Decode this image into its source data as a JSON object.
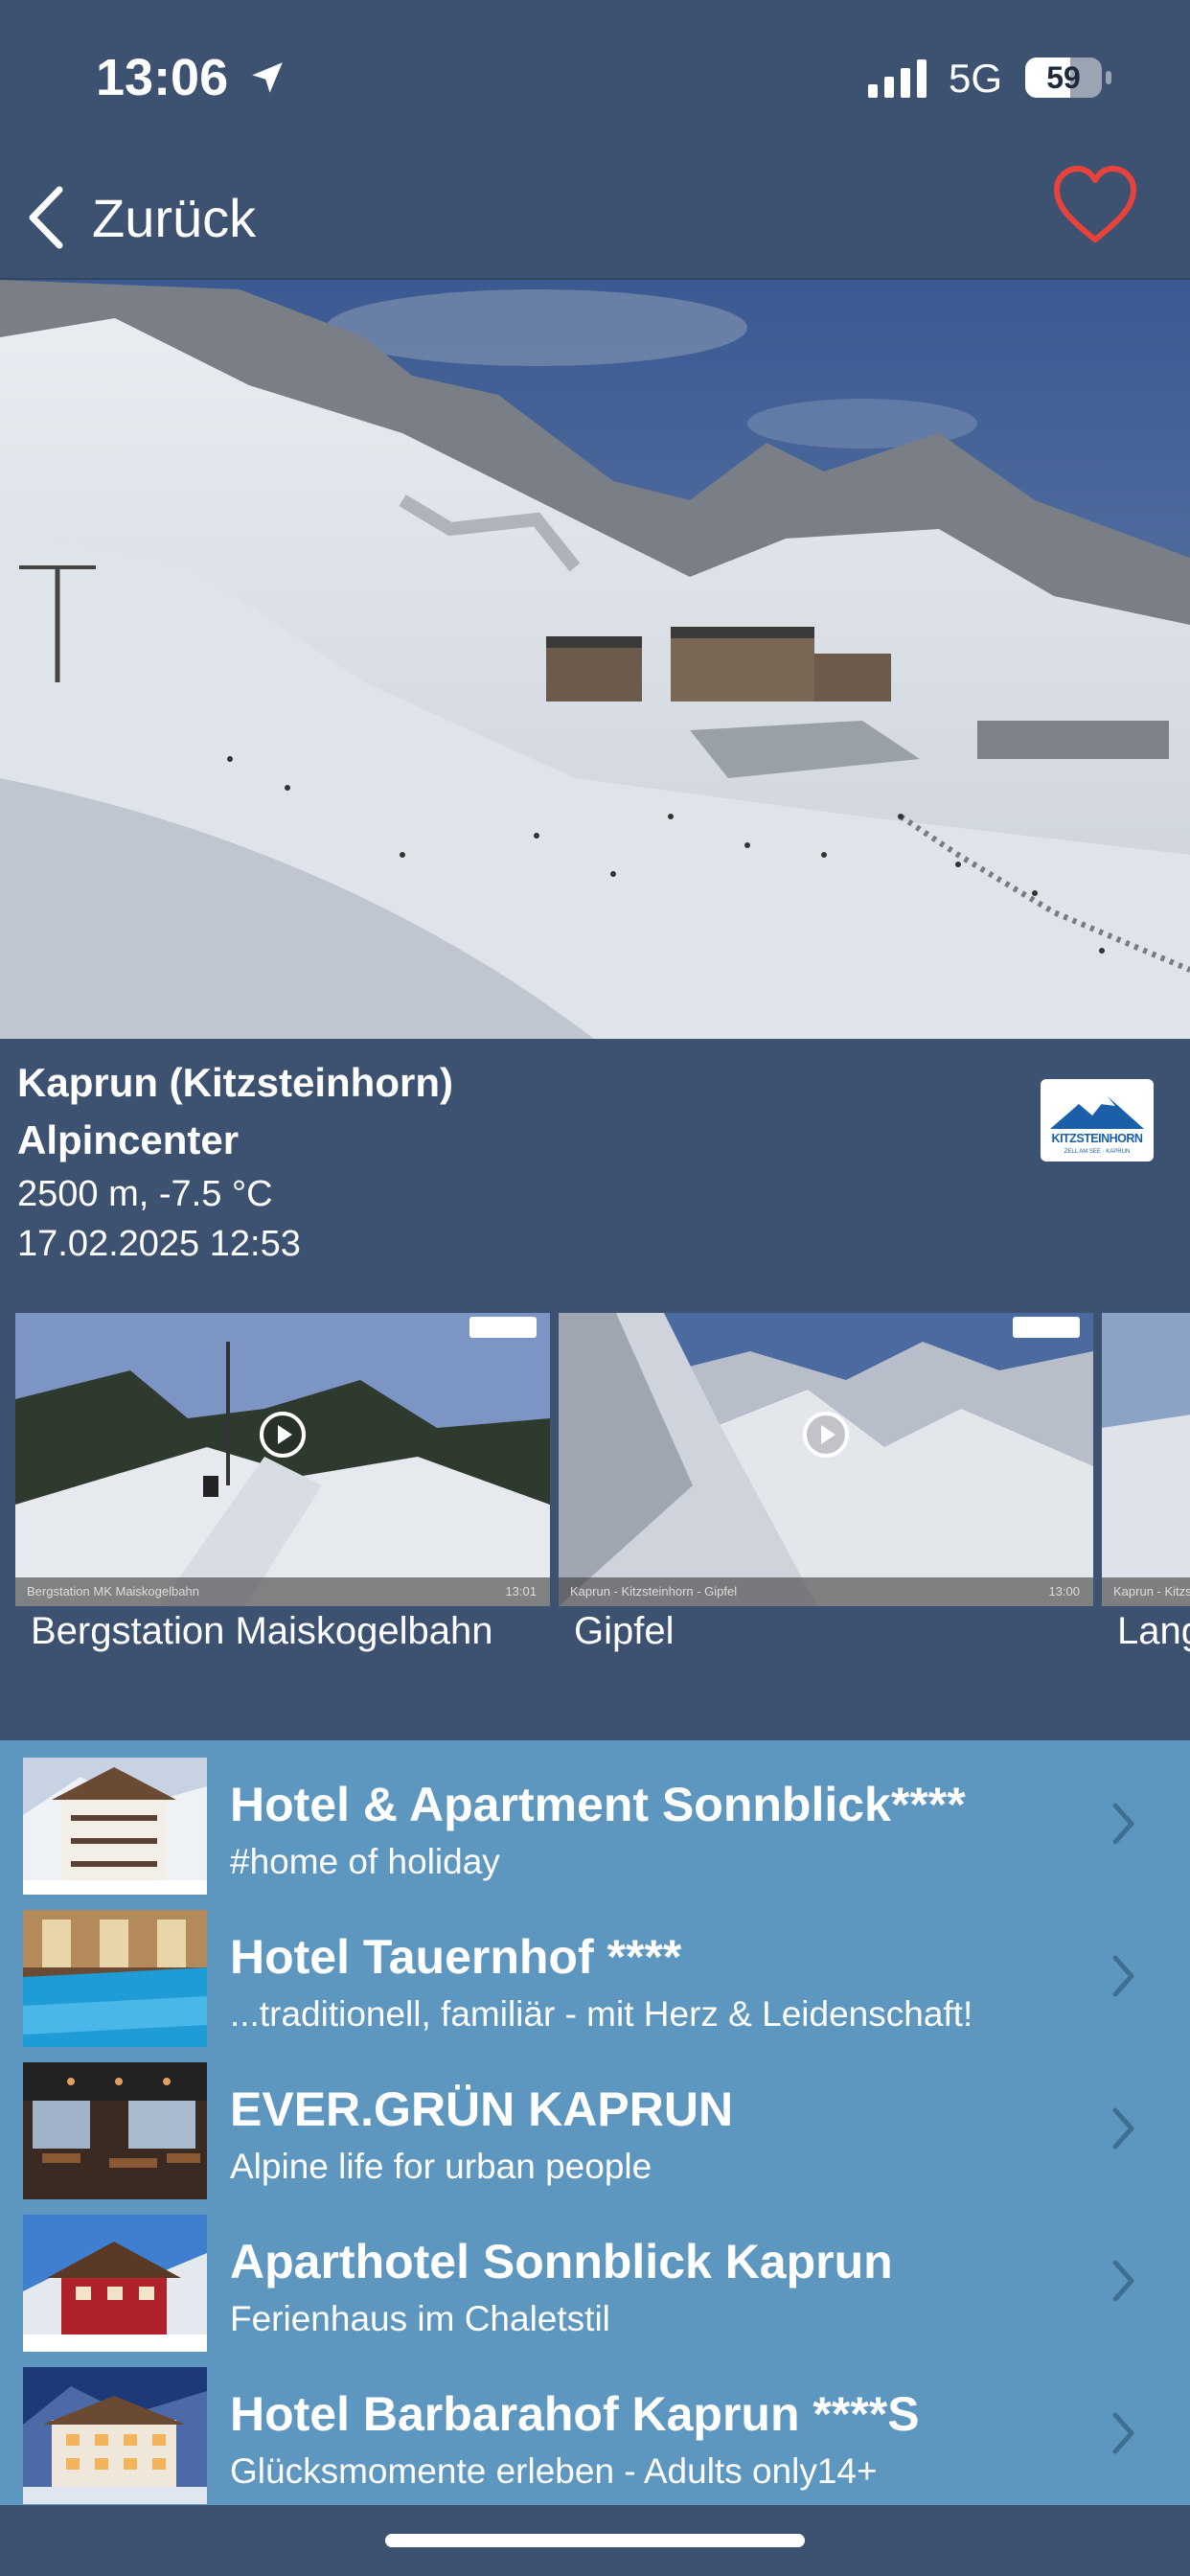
{
  "status_bar": {
    "time": "13:06",
    "network": "5G",
    "battery": "59",
    "battery_level": 0.59,
    "icons": [
      "location-arrow-icon",
      "cellular-signal-icon",
      "battery-icon"
    ]
  },
  "nav": {
    "back_label": "Zurück",
    "favorite_icon": "heart-outline-icon",
    "favorite_color": "#e8423c"
  },
  "webcam": {
    "title_line1": "Kaprun (Kitzsteinhorn)",
    "title_line2": "Alpincenter",
    "altitude_temp": "2500 m, -7.5 °C",
    "timestamp": "17.02.2025 12:53",
    "brand_logo_text": "KITZSTEINHORN",
    "brand_logo_subtext": "ZELL AM SEE · KAPRUN"
  },
  "related_cams": [
    {
      "label": "Bergstation Maiskogelbahn",
      "caption_left": "Bergstation MK Maiskogelbahn",
      "caption_right": "13:01"
    },
    {
      "label": "Gipfel",
      "caption_left": "Kaprun - Kitzsteinhorn - Gipfel",
      "caption_right": "13:00"
    },
    {
      "label": "Lang",
      "caption_left": "Kaprun - Kitzst",
      "caption_right": ""
    }
  ],
  "hotels": [
    {
      "name": "Hotel & Apartment Sonnblick****",
      "tagline": "#home of holiday"
    },
    {
      "name": "Hotel Tauernhof ****",
      "tagline": "...traditionell, familiär - mit Herz & Leidenschaft!"
    },
    {
      "name": "EVER.GRÜN KAPRUN",
      "tagline": "Alpine life for urban people"
    },
    {
      "name": "Aparthotel Sonnblick Kaprun",
      "tagline": "Ferienhaus im Chaletstil"
    },
    {
      "name": "Hotel Barbarahof Kaprun ****S",
      "tagline": "Glücksmomente erleben - Adults only14+"
    }
  ],
  "colors": {
    "background": "#3d5270",
    "hotel_list_bg": "#5d97bf",
    "heart": "#e8423c"
  }
}
